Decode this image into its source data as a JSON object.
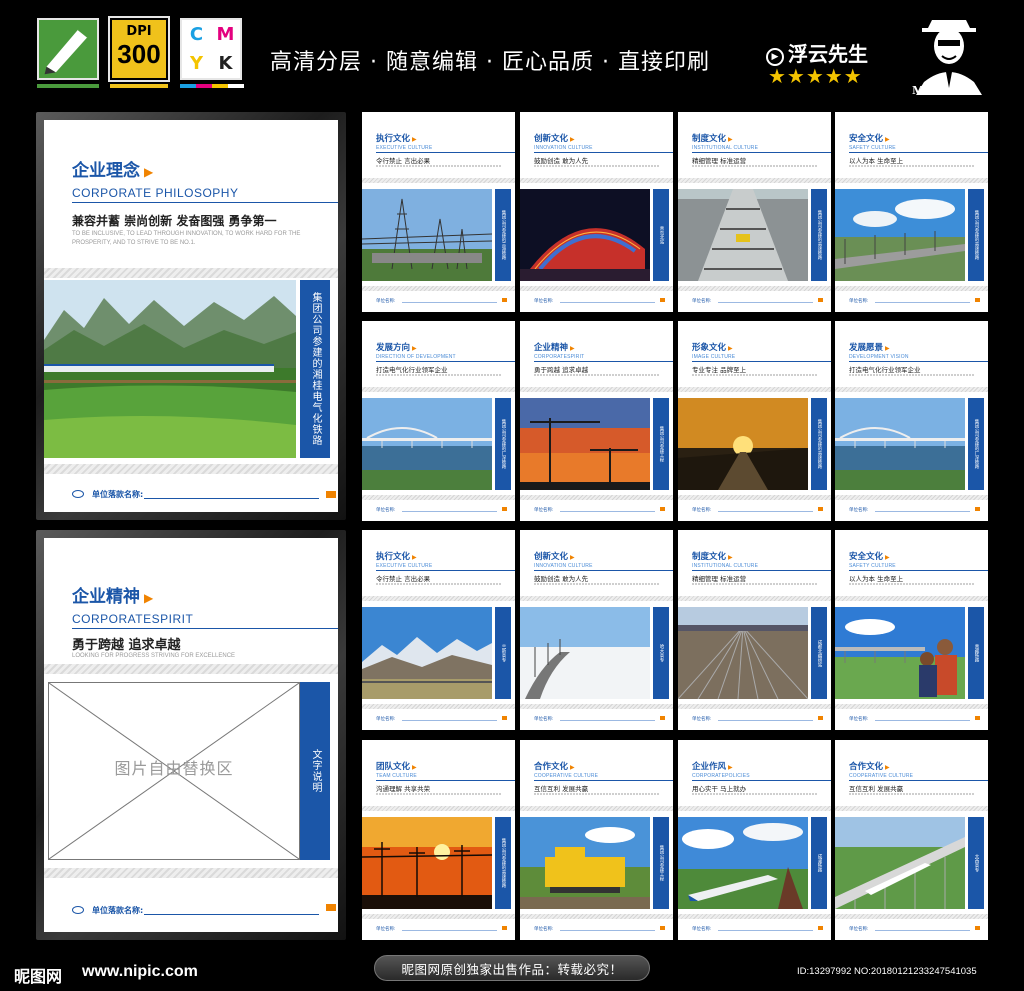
{
  "header": {
    "dpi_label": "DPI",
    "dpi_value": "300",
    "cmyk": [
      "C",
      "M",
      "Y",
      "K"
    ],
    "slogan": "高清分层 · 随意编辑 · 匠心品质 · 直接印刷",
    "brand": "浮云先生",
    "stars": "★★★★★",
    "signature": "Mr.cloud",
    "colors": {
      "cyan": "#1aa0e3",
      "magenta": "#e4007f",
      "yellow": "#f4c400",
      "blue": "#1b56a8",
      "orange": "#f08300"
    }
  },
  "big_boards": [
    {
      "title": "企业理念",
      "title_en": "CORPORATE PHILOSOPHY",
      "slogan": "兼容并蓄  崇尚创新  发奋图强  勇争第一",
      "sub_en": "TO BE INCLUSIVE, TO LEAD THROUGH INNOVATION, TO WORK HARD FOR THE PROSPERITY, AND TO STRIVE TO BE NO.1.",
      "side_text": "集团公司参建的湘桂电气化铁路",
      "footer_label": "单位落款名称:"
    },
    {
      "title": "企业精神",
      "title_en": "CORPORATESPIRIT",
      "slogan": "勇于跨越  追求卓越",
      "sub_en": "LOOKING FOR PROGRESS  STRIVING FOR EXCELLENCE",
      "placeholder": "图片自由替换区",
      "side_text": "文字说明",
      "footer_label": "单位落款名称:"
    }
  ],
  "cards": [
    {
      "title": "执行文化",
      "en": "EXECUTIVE CULTURE",
      "sub": "令行禁止  言出必果",
      "side": "集团公司参建的兰渝铁路",
      "scene": "substation",
      "footer": "单位名称:"
    },
    {
      "title": "创新文化",
      "en": "INNOVATION CULTURE",
      "sub": "鼓励创造  敢为人先",
      "side": "青岛北站",
      "scene": "station-night",
      "footer": "单位名称:"
    },
    {
      "title": "制度文化",
      "en": "INSTITUTIONAL CULTURE",
      "sub": "精细管理  标准运营",
      "side": "集团公司参建的高速铁路",
      "scene": "track",
      "footer": "单位名称:"
    },
    {
      "title": "安全文化",
      "en": "SAFETY CULTURE",
      "sub": "以人为本  生命至上",
      "side": "集团公司参建的高速铁路",
      "scene": "railway-sky",
      "footer": "单位名称:"
    },
    {
      "title": "发展方向",
      "en": "DIRECTION OF DEVELOPMENT",
      "sub": "打造电气化行业领军企业",
      "side": "集团公司参建的广深铁路",
      "scene": "bridge",
      "footer": "单位名称:"
    },
    {
      "title": "企业精神",
      "en": "CORPORATESPIRIT",
      "sub": "勇于跨越  追求卓越",
      "side": "集团公司参建工程",
      "scene": "crane-sunset",
      "footer": "单位名称:"
    },
    {
      "title": "形象文化",
      "en": "IMAGE CULTURE",
      "sub": "专业专注  品牌至上",
      "side": "集团公司参建的高速铁路",
      "scene": "sunset-rail",
      "footer": "单位名称:"
    },
    {
      "title": "发展愿景",
      "en": "DEVELOPMENT VISION",
      "sub": "打造电气化行业领军企业",
      "side": "集团公司参建的广深铁路",
      "scene": "bridge",
      "footer": "单位名称:"
    },
    {
      "title": "执行文化",
      "en": "EXECUTIVE CULTURE",
      "sub": "令行禁止  言出必果",
      "side": "兰新高专",
      "scene": "mountains",
      "footer": "单位名称:"
    },
    {
      "title": "创新文化",
      "en": "INNOVATION CULTURE",
      "sub": "鼓励创造  敢为人先",
      "side": "哈大高专",
      "scene": "snow",
      "footer": "单位名称:"
    },
    {
      "title": "制度文化",
      "en": "INSTITUTIONAL CULTURE",
      "sub": "精细管理  标准运营",
      "side": "成都北编组站",
      "scene": "yard",
      "footer": "单位名称:"
    },
    {
      "title": "安全文化",
      "en": "SAFETY CULTURE",
      "sub": "以人为本  生命至上",
      "side": "青藏铁路",
      "scene": "people",
      "footer": "单位名称:"
    },
    {
      "title": "团队文化",
      "en": "TEAM CULTURE",
      "sub": "沟通理解  共享共荣",
      "side": "集团公司参建的高速铁路",
      "scene": "sunset-poles",
      "footer": "单位名称:"
    },
    {
      "title": "合作文化",
      "en": "COOPERATIVE CULTURE",
      "sub": "互信互利  发展共赢",
      "side": "集团公司参建工程",
      "scene": "machine",
      "footer": "单位名称:"
    },
    {
      "title": "企业作风",
      "en": "CORPORATEPOLICIES",
      "sub": "用心实干  马上就办",
      "side": "成灌铁路",
      "scene": "train",
      "footer": "单位名称:"
    },
    {
      "title": "合作文化",
      "en": "COOPERATIVE CULTURE",
      "sub": "互信互利  发展共赢",
      "side": "大西高专",
      "scene": "viaduct",
      "footer": "单位名称:"
    }
  ],
  "footer": {
    "site_name": "昵图网",
    "site_url": "www.nipic.com",
    "notice": "昵图网原创独家出售作品：转载必究！",
    "id_line": "ID:13297992 NO:20180121233247541035"
  }
}
